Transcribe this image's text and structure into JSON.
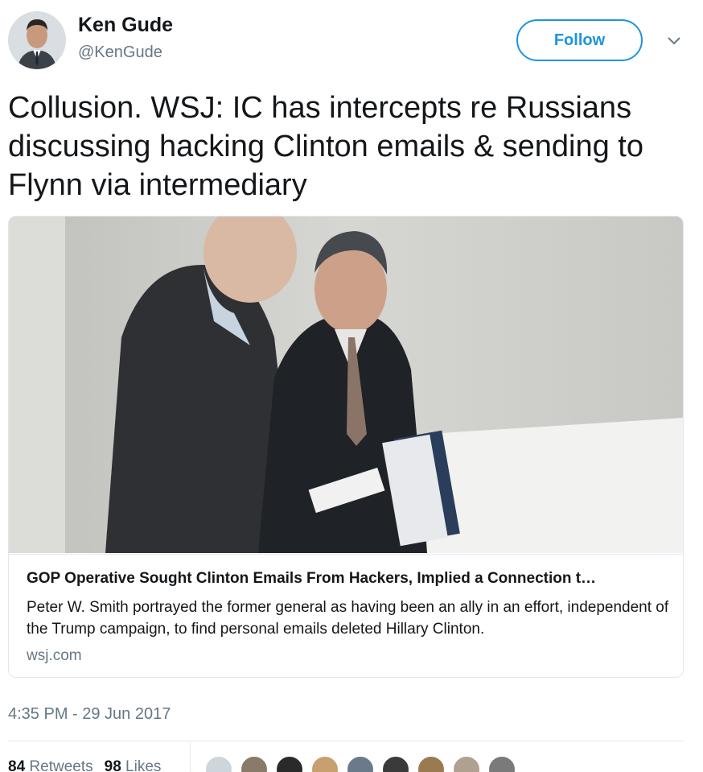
{
  "user": {
    "name": "Ken Gude",
    "handle": "@KenGude",
    "follow_label": "Follow"
  },
  "tweet": {
    "text": "Collusion. WSJ: IC has intercepts re Russians discussing hacking Clinton emails & sending to Flynn via intermediary"
  },
  "card": {
    "title": "GOP Operative Sought Clinton Emails From Hackers, Implied a Connection t…",
    "description": "Peter W. Smith portrayed the former general as having been an ally in an effort, independent of the Trump campaign, to find personal emails deleted Hillary Clinton.",
    "domain": "wsj.com"
  },
  "timestamp": "4:35 PM - 29 Jun 2017",
  "stats": {
    "retweets_count": "84",
    "retweets_label": "Retweets",
    "likes_count": "98",
    "likes_label": "Likes"
  },
  "likers": [
    {
      "color": "#cfd6db"
    },
    {
      "color": "#8a7a6a"
    },
    {
      "color": "#2a2a2a"
    },
    {
      "color": "#c8a070"
    },
    {
      "color": "#6a7a8a"
    },
    {
      "color": "#3a3a3a"
    },
    {
      "color": "#9a7a50"
    },
    {
      "color": "#b0a090"
    },
    {
      "color": "#7a7a7a"
    }
  ],
  "colors": {
    "accent": "#1b95e0",
    "secondary_text": "#657786",
    "border": "#e1e8ed"
  },
  "icons": {
    "caret": "chevron-down-icon"
  }
}
